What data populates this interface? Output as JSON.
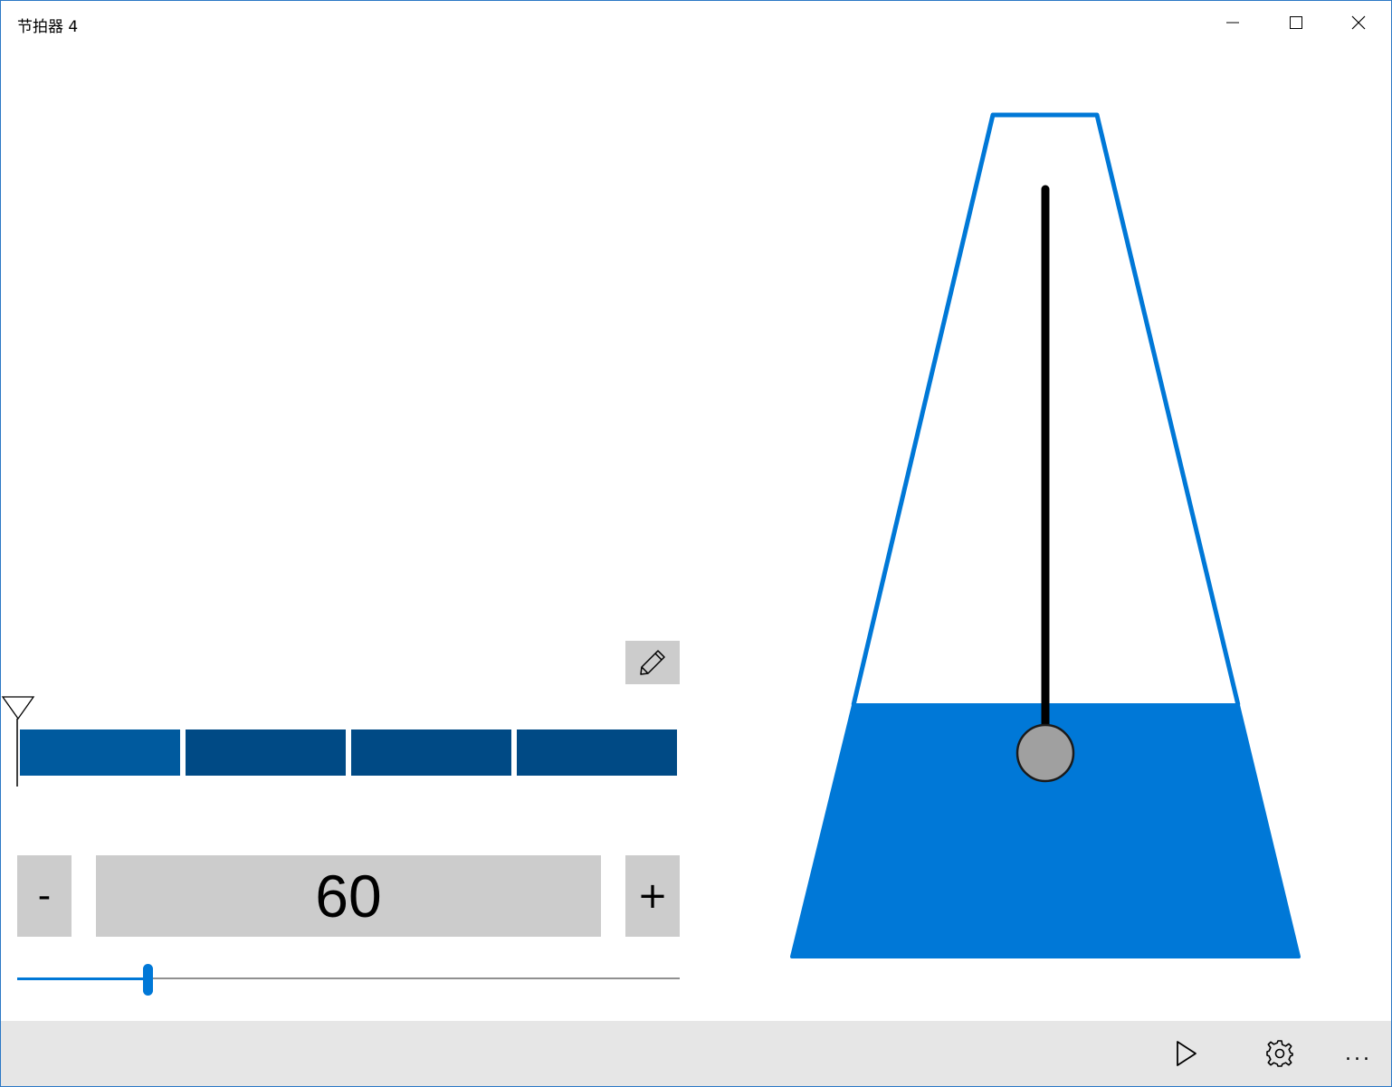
{
  "window": {
    "title": "节拍器 4",
    "accent_color": "#0078d7"
  },
  "caption_buttons": {
    "minimize_icon": "minimize-icon",
    "maximize_icon": "maximize-icon",
    "close_icon": "close-icon"
  },
  "beat_editor": {
    "edit_icon": "pencil-icon",
    "beat_count": 4,
    "active_beat_index": 0,
    "beat_color": "#004a85",
    "active_beat_color": "#005a9e"
  },
  "tempo": {
    "decrement_label": "-",
    "increment_label": "+",
    "bpm": "60",
    "slider_fraction": 0.197
  },
  "metronome": {
    "body_color": "#0078d7",
    "bob_color": "#a0a0a0",
    "pendulum_color": "#000000"
  },
  "command_bar": {
    "play_icon": "play-icon",
    "settings_icon": "gear-icon",
    "more_label": "..."
  }
}
